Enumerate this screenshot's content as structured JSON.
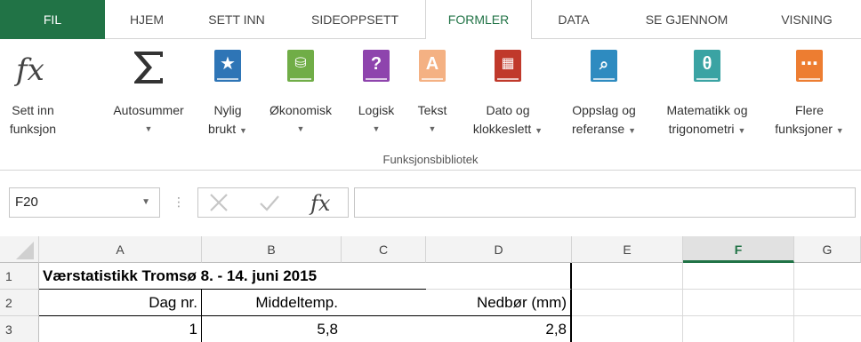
{
  "tabs": [
    {
      "label": "FIL"
    },
    {
      "label": "HJEM"
    },
    {
      "label": "SETT INN"
    },
    {
      "label": "SIDEOPPSETT"
    },
    {
      "label": "FORMLER"
    },
    {
      "label": "DATA"
    },
    {
      "label": "SE GJENNOM"
    },
    {
      "label": "VISNING"
    }
  ],
  "active_tab": "FORMLER",
  "ribbon": {
    "insert_function": {
      "line1": "Sett inn",
      "line2": "funksjon",
      "icon": "fx-icon"
    },
    "autosum": {
      "line1": "Autosummer",
      "icon": "sigma-icon"
    },
    "recent": {
      "line1": "Nylig",
      "line2": "brukt",
      "icon": "star-book-icon"
    },
    "financial": {
      "line1": "Økonomisk",
      "icon": "coins-book-icon"
    },
    "logical": {
      "line1": "Logisk",
      "icon": "question-book-icon"
    },
    "text": {
      "line1": "Tekst",
      "icon": "letter-a-book-icon"
    },
    "datetime": {
      "line1": "Dato og",
      "line2": "klokkeslett",
      "icon": "calendar-book-icon"
    },
    "lookup": {
      "line1": "Oppslag og",
      "line2": "referanse",
      "icon": "magnifier-book-icon"
    },
    "math": {
      "line1": "Matematikk og",
      "line2": "trigonometri",
      "icon": "theta-book-icon"
    },
    "more": {
      "line1": "Flere",
      "line2": "funksjoner",
      "icon": "ellipsis-book-icon"
    },
    "group_label": "Funksjonsbibliotek"
  },
  "formula_bar": {
    "name_box": "F20",
    "fx_symbol": "fx",
    "formula": ""
  },
  "grid": {
    "columns": [
      "A",
      "B",
      "C",
      "D",
      "E",
      "F",
      "G"
    ],
    "selected_column": "F",
    "rows": [
      {
        "num": "1",
        "a": "Værstatistikk Tromsø 8. - 14. juni 2015",
        "b": "",
        "c": "",
        "d": ""
      },
      {
        "num": "2",
        "a": "Dag nr.",
        "b": "Middeltemp.",
        "c": "",
        "d": "Nedbør (mm)"
      },
      {
        "num": "3",
        "a": "1",
        "b": "5,8",
        "c": "",
        "d": "2,8"
      }
    ]
  },
  "colors": {
    "accent": "#217346",
    "book_blue": "#2e75b6",
    "book_green": "#70ad47",
    "book_purple": "#8e44ad",
    "book_orange_light": "#f4b183",
    "book_red": "#c0392b",
    "book_cyan": "#2e8bc0",
    "book_teal": "#3aa3a3",
    "book_orange": "#ed7d31"
  }
}
